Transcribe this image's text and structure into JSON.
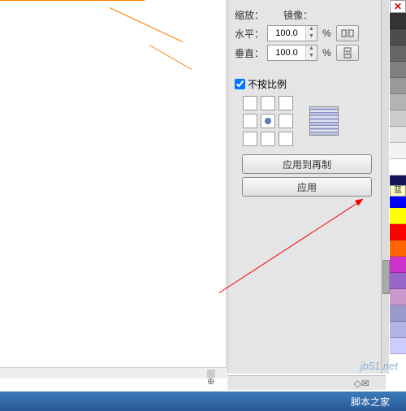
{
  "panel": {
    "scale_label": "缩放：",
    "mirror_label": "镜像：",
    "h_label": "水平：",
    "v_label": "垂直：",
    "h_value": "100.0",
    "v_value": "100.0",
    "pct": "%",
    "checkbox_label": "不按比例",
    "checkbox_checked": true,
    "apply_copy": "应用到再制",
    "apply": "应用"
  },
  "swatches": {
    "colors": [
      "#333333",
      "#4d4d4d",
      "#666666",
      "#808080",
      "#999999",
      "#b3b3b3",
      "#cccccc",
      "#e6e6e6",
      "#f2f2f2",
      "#ffffff",
      "#14145a",
      "#0000ff",
      "#ffff00",
      "#ff0000",
      "#ff6600",
      "#cc33cc",
      "#9966cc",
      "#cc99cc",
      "#9999cc",
      "#b3b3e6",
      "#ccccff"
    ],
    "tooltip": "蓝"
  },
  "watermark": "jb51.net",
  "footer": "脚本之家",
  "status_icons": "◇✉"
}
